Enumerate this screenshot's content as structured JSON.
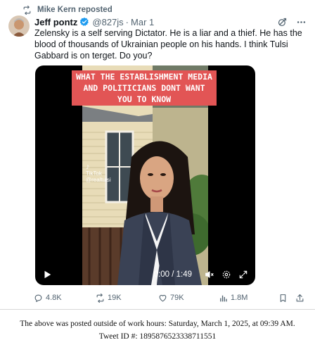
{
  "repost": {
    "label": "Mike Kern reposted"
  },
  "post": {
    "author": "Jeff pontz",
    "handle": "@827js",
    "separator": "·",
    "date": "Mar 1",
    "text": "Zelensky is a self serving Dictator. He is a liar and a thief. He has the blood of thousands of Ukrainian people on his hands. I think Tulsi Gabbard is on terget. Do you?"
  },
  "video": {
    "caption": "WHAT THE ESTABLISHMENT MEDIA AND POLITICIANS DONT WANT YOU TO KNOW",
    "watermark_brand": "TikTok",
    "watermark_handle": "@realtulsi",
    "time": "0:00 / 1:49"
  },
  "actions": {
    "replies": "4.8K",
    "reposts": "19K",
    "likes": "79K",
    "views": "1.8M"
  },
  "footer": {
    "line1": "The above was posted outside of work hours: Saturday, March 1, 2025, at 09:39 AM.",
    "line2": "Tweet ID #: 1895876523338711551"
  },
  "colors": {
    "verified": "#1d9bf0",
    "secondary_text": "#536471",
    "caption_bg": "#e25555"
  },
  "icons": [
    "repost-icon",
    "verified-badge-icon",
    "grok-icon",
    "more-icon",
    "play-icon",
    "mute-icon",
    "settings-icon",
    "fullscreen-icon",
    "reply-icon",
    "like-icon",
    "views-icon",
    "bookmark-icon",
    "share-icon"
  ]
}
